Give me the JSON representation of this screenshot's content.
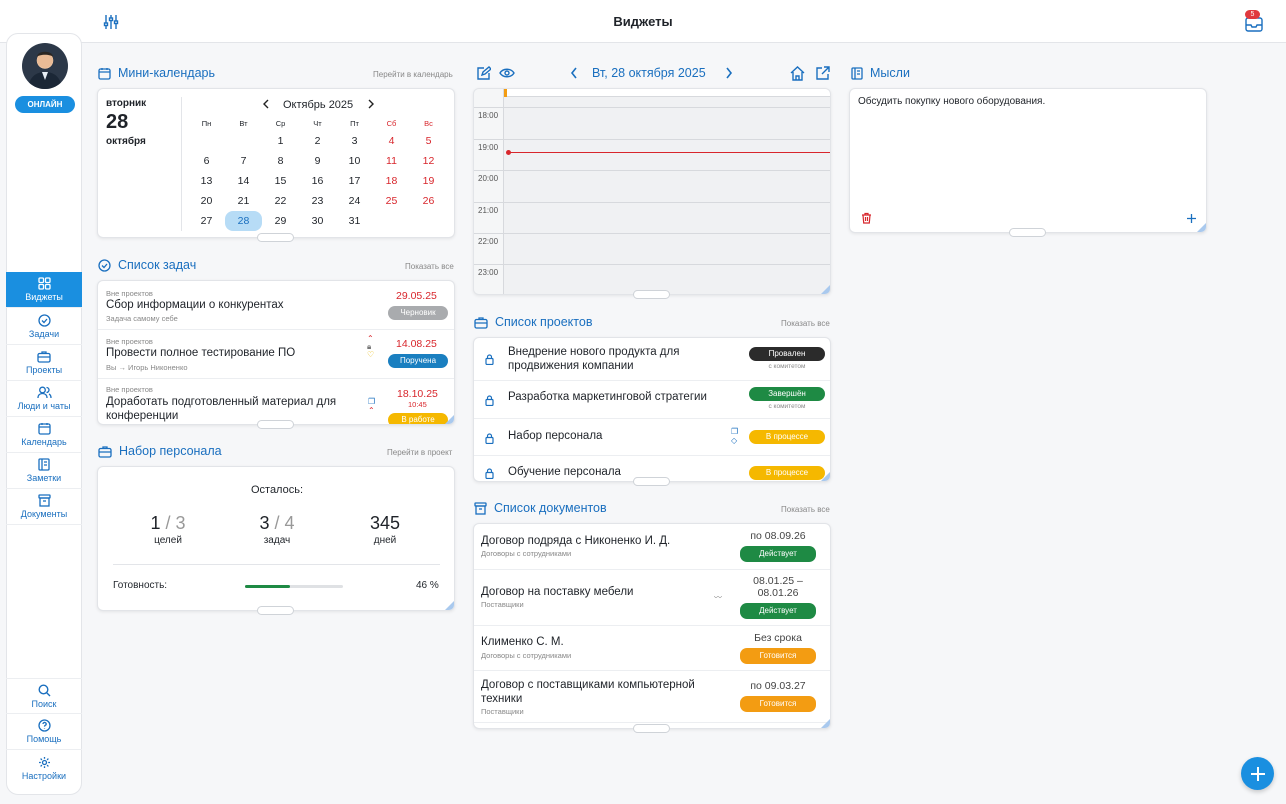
{
  "header": {
    "title": "Виджеты",
    "inbox_count": "5"
  },
  "colors": {
    "accent": "#1a8fe0",
    "link": "#1a6fbf",
    "danger": "#d8262c",
    "success": "#1e8a44",
    "warning": "#f5b800",
    "orange": "#f39c12"
  },
  "sidebar": {
    "status": "ОНЛАЙН",
    "items": [
      {
        "label": "Виджеты",
        "icon": "grid-icon"
      },
      {
        "label": "Задачи",
        "icon": "check-circle-icon"
      },
      {
        "label": "Проекты",
        "icon": "briefcase-icon"
      },
      {
        "label": "Люди и чаты",
        "icon": "people-icon"
      },
      {
        "label": "Календарь",
        "icon": "calendar-icon"
      },
      {
        "label": "Заметки",
        "icon": "notes-icon"
      },
      {
        "label": "Документы",
        "icon": "archive-icon"
      }
    ],
    "bottom": [
      {
        "label": "Поиск",
        "icon": "search-icon"
      },
      {
        "label": "Помощь",
        "icon": "help-icon"
      },
      {
        "label": "Настройки",
        "icon": "gear-icon"
      }
    ]
  },
  "mini_calendar": {
    "title": "Мини-календарь",
    "link": "Перейти в календарь",
    "weekday": "вторник",
    "day": "28",
    "month": "октября",
    "month_label": "Октябрь 2025",
    "weekdays": [
      "Пн",
      "Вт",
      "Ср",
      "Чт",
      "Пт",
      "Сб",
      "Вс"
    ],
    "weeks": [
      [
        "",
        "",
        "1",
        "2",
        "3",
        "4",
        "5"
      ],
      [
        "6",
        "7",
        "8",
        "9",
        "10",
        "11",
        "12"
      ],
      [
        "13",
        "14",
        "15",
        "16",
        "17",
        "18",
        "19"
      ],
      [
        "20",
        "21",
        "22",
        "23",
        "24",
        "25",
        "26"
      ],
      [
        "27",
        "28",
        "29",
        "30",
        "31",
        "",
        ""
      ]
    ],
    "selected": "28"
  },
  "tasks": {
    "title": "Список задач",
    "link": "Показать все",
    "items": [
      {
        "context": "Вне проектов",
        "name": "Сбор информации о конкурентах",
        "sub": "Задача самому себе",
        "date": "29.05.25",
        "time": "",
        "status": "Черновик",
        "status_color": "#a9abae"
      },
      {
        "context": "Вне проектов",
        "name": "Провести полное тестирование ПО",
        "sub": "Вы → Игорь Никоненко",
        "date": "14.08.25",
        "time": "",
        "status": "Поручена",
        "status_color": "#1a7fc0"
      },
      {
        "context": "Вне проектов",
        "name": "Доработать подготовленный материал для конференции",
        "sub": "",
        "date": "18.10.25",
        "time": "10:45",
        "status": "В работе",
        "status_color": "#f5b800"
      }
    ]
  },
  "recruitment": {
    "title": "Набор персонала",
    "link": "Перейти в проект",
    "remaining": "Осталось:",
    "stats": [
      {
        "done": "1",
        "total": "3",
        "label": "целей"
      },
      {
        "done": "3",
        "total": "4",
        "label": "задач"
      },
      {
        "done": "345",
        "total": "",
        "label": "дней"
      }
    ],
    "readiness_label": "Готовность:",
    "readiness": 46,
    "readiness_text": "46 %"
  },
  "day_view": {
    "date": "Вт, 28 октября 2025",
    "hours": [
      "18:00",
      "19:00",
      "20:00",
      "21:00",
      "22:00",
      "23:00"
    ]
  },
  "projects": {
    "title": "Список проектов",
    "link": "Показать все",
    "items": [
      {
        "name": "Внедрение нового продукта для продвижения компании",
        "status": "Провален",
        "note": "с комитетом",
        "color": "#2b2b2b"
      },
      {
        "name": "Разработка маркетинговой стратегии",
        "status": "Завершён",
        "note": "с комитетом",
        "color": "#1e8a44"
      },
      {
        "name": "Набор персонала",
        "status": "В процессе",
        "note": "",
        "color": "#f5b800"
      },
      {
        "name": "Обучение персонала",
        "status": "В процессе",
        "note": "",
        "color": "#f5b800"
      }
    ]
  },
  "documents": {
    "title": "Список документов",
    "link": "Показать все",
    "items": [
      {
        "name": "Договор подряда с Никоненко И. Д.",
        "category": "Договоры с сотрудниками",
        "date": "по 08.09.26",
        "status": "Действует",
        "color": "#1e8a44"
      },
      {
        "name": "Договор на поставку мебели",
        "category": "Поставщики",
        "date": "08.01.25 –\n08.01.26",
        "status": "Действует",
        "color": "#1e8a44"
      },
      {
        "name": "Клименко С. М.",
        "category": "Договоры с сотрудниками",
        "date": "Без срока",
        "status": "Готовится",
        "color": "#f39c12"
      },
      {
        "name": "Договор с поставщиками компьютерной техники",
        "category": "Поставщики",
        "date": "по 09.03.27",
        "status": "Готовится",
        "color": "#f39c12"
      }
    ]
  },
  "thoughts": {
    "title": "Мысли",
    "text": "Обсудить покупку нового оборудования."
  }
}
